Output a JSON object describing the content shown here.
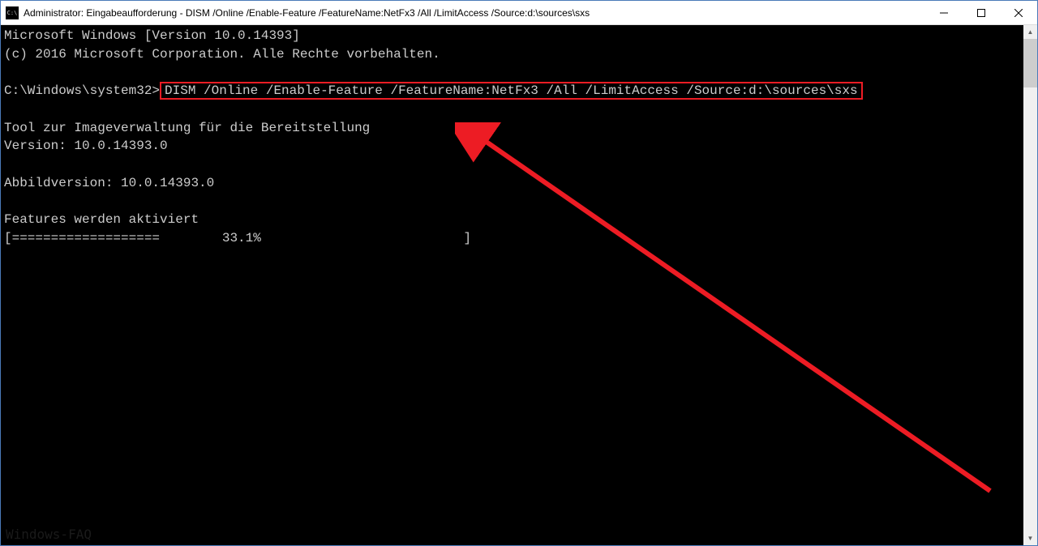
{
  "titlebar": {
    "text": "Administrator: Eingabeaufforderung - DISM  /Online /Enable-Feature /FeatureName:NetFx3 /All /LimitAccess /Source:d:\\sources\\sxs"
  },
  "console": {
    "line1": "Microsoft Windows [Version 10.0.14393]",
    "line2": "(c) 2016 Microsoft Corporation. Alle Rechte vorbehalten.",
    "prompt": "C:\\Windows\\system32>",
    "command": "DISM /Online /Enable-Feature /FeatureName:NetFx3 /All /LimitAccess /Source:d:\\sources\\sxs",
    "tool_line1": "Tool zur Imageverwaltung für die Bereitstellung",
    "tool_line2": "Version: 10.0.14393.0",
    "abbild": "Abbildversion: 10.0.14393.0",
    "features": "Features werden aktiviert",
    "progress": "[===================        33.1%                          ] "
  },
  "watermark": "Windows-FAQ"
}
